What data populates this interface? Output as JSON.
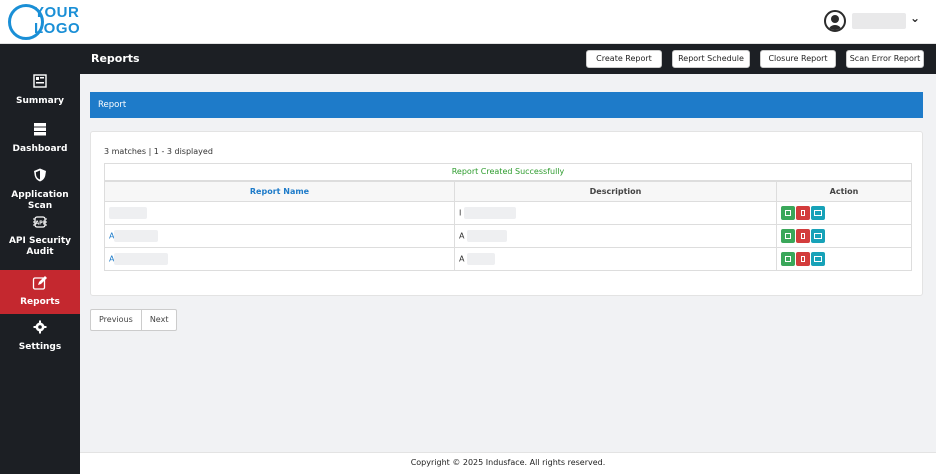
{
  "logo": {
    "line1": "YOUR",
    "line2": "LOGO"
  },
  "user": {
    "caret": "⌄"
  },
  "sidebar": {
    "items": [
      {
        "label": "Summary",
        "icon": "summary-icon"
      },
      {
        "label": "Dashboard",
        "icon": "dashboard-icon"
      },
      {
        "label": "Application Scan",
        "icon": "shield-icon"
      },
      {
        "label": "API Security Audit",
        "icon": "api-icon"
      },
      {
        "label": "Reports",
        "icon": "edit-icon",
        "active": true
      },
      {
        "label": "Settings",
        "icon": "gear-icon"
      }
    ]
  },
  "header": {
    "title": "Reports",
    "buttons": [
      "Create Report",
      "Report Schedule",
      "Closure Report",
      "Scan Error Report"
    ]
  },
  "band": {
    "label": "Report"
  },
  "results": {
    "matches": "3 matches | 1 - 3 displayed",
    "success": "Report Created Successfully",
    "columns": [
      "Report Name",
      "Description",
      "Action"
    ],
    "rows": [
      {
        "name": "",
        "desc": "I"
      },
      {
        "name": "A",
        "desc": "A"
      },
      {
        "name": "A",
        "desc": "A"
      }
    ]
  },
  "pagination": {
    "prev": "Previous",
    "next": "Next"
  },
  "footer": "Copyright © 2025 Indusface. All rights reserved.",
  "colors": {
    "accent": "#1e7bc9",
    "active_nav": "#c4282f",
    "sidebar": "#1c1f24",
    "success": "#2e9c2e"
  }
}
